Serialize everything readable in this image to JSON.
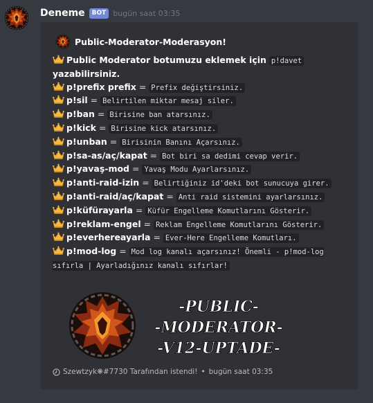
{
  "message": {
    "username": "Deneme",
    "bot_tag": "BOT",
    "timestamp": "bugün saat 03:35"
  },
  "embed": {
    "author": "Public-Moderator-Moderasyon!",
    "intro_text": "Public Moderator botumuzu eklemek için",
    "intro_code": "p!davet",
    "intro_text2": "yazabilirsiniz.",
    "commands": [
      {
        "cmd": "p!prefix prefix",
        "desc": "Prefix değiştirsiniz."
      },
      {
        "cmd": "p!sil",
        "desc": "Belirtilen miktar mesaj siler."
      },
      {
        "cmd": "p!ban",
        "desc": "Birisine ban atarsınız."
      },
      {
        "cmd": "p!kick",
        "desc": "Birisine kick atarsınız."
      },
      {
        "cmd": "p!unban",
        "desc": "Birisinin Banını Açarsınız."
      },
      {
        "cmd": "p!sa-as/aç/kapat",
        "desc": "Bot biri sa dedimi cevap verir."
      },
      {
        "cmd": "p!yavaş-mod",
        "desc": "Yavaş Modu Ayarlarsınız."
      },
      {
        "cmd": "p!anti-raid-izin",
        "desc": "Belirtiğiniz id'deki bot sunucuya girer."
      },
      {
        "cmd": "p!anti-raid/aç/kapat",
        "desc": "Anti raid sistemini ayarlarsınız."
      },
      {
        "cmd": "p!küfürayarla",
        "desc": "Küfür Engelleme Komutlarını Gösterir."
      },
      {
        "cmd": "p!reklam-engel",
        "desc": "Reklam Engelleme Komutlarını Gösterir."
      },
      {
        "cmd": "p!everhereayarla",
        "desc": "Ever-Here Engelleme Komutları."
      }
    ],
    "modlog_cmd": "p!mod-log",
    "modlog_desc": "Mod log kanalı açarsınız! Önemli - p!mod-log sıfırla | Ayarladığınız kanalı sıfırlar!",
    "image_lines": [
      "-PUBLIC-",
      "-MODERATOR-",
      "-V12-UPTADE-"
    ],
    "footer_text": "Szewtzyk❋#7730 Tarafından istendi!",
    "footer_time": "bugün saat 03:35"
  },
  "colors": {
    "background": "#36393f",
    "embed_bg": "#2f3136",
    "bot_tag": "#7289da",
    "crown": "#f5b942"
  },
  "icons": {
    "crown": "crown-emoji-icon",
    "avatar": "flaming-shield-logo",
    "footer": "clock-icon"
  }
}
